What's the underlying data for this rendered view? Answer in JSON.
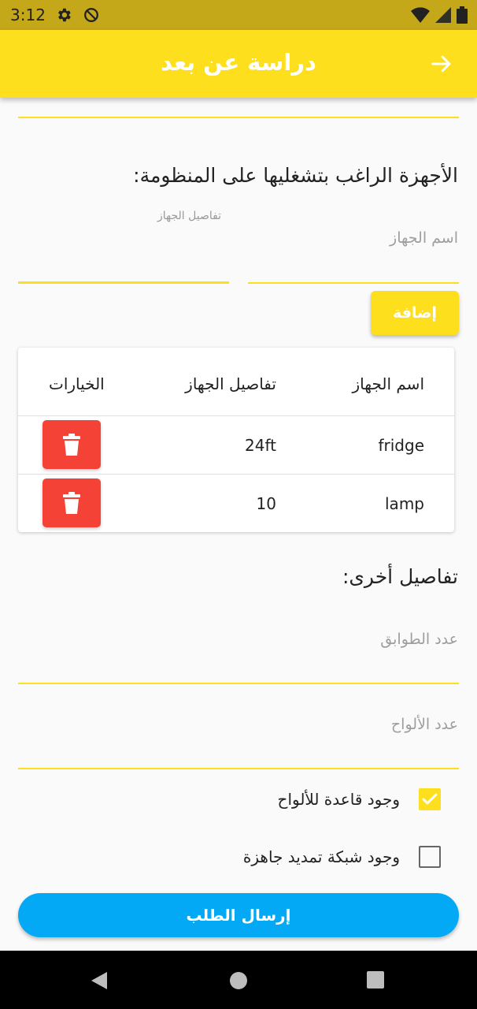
{
  "status_bar": {
    "time": "3:12"
  },
  "app_bar": {
    "title": "دراسة عن بعد"
  },
  "devices_section": {
    "heading": "الأجهزة الراغب بتشغليها على المنظومة:",
    "device_details_label": "تفاصيل الجهاز",
    "device_name_placeholder": "اسم الجهاز",
    "add_label": "إضافة"
  },
  "table": {
    "headers": {
      "name": "اسم الجهاز",
      "details": "تفاصيل الجهاز",
      "options": "الخيارات"
    },
    "rows": [
      {
        "name": "fridge",
        "details": "24ft"
      },
      {
        "name": "lamp",
        "details": "10"
      }
    ]
  },
  "other_section": {
    "heading": "تفاصيل أخرى:",
    "floors_placeholder": "عدد الطوابق",
    "panels_placeholder": "عدد الألواح",
    "checks": [
      {
        "label": "وجود قاعدة للألواح",
        "checked": true
      },
      {
        "label": "وجود شبكة تمديد جاهزة",
        "checked": false
      }
    ]
  },
  "submit_label": "إرسال الطلب",
  "colors": {
    "accent": "#fddf1e",
    "status_bar": "#c4a81a",
    "submit": "#03a9f4",
    "delete": "#f44336"
  }
}
